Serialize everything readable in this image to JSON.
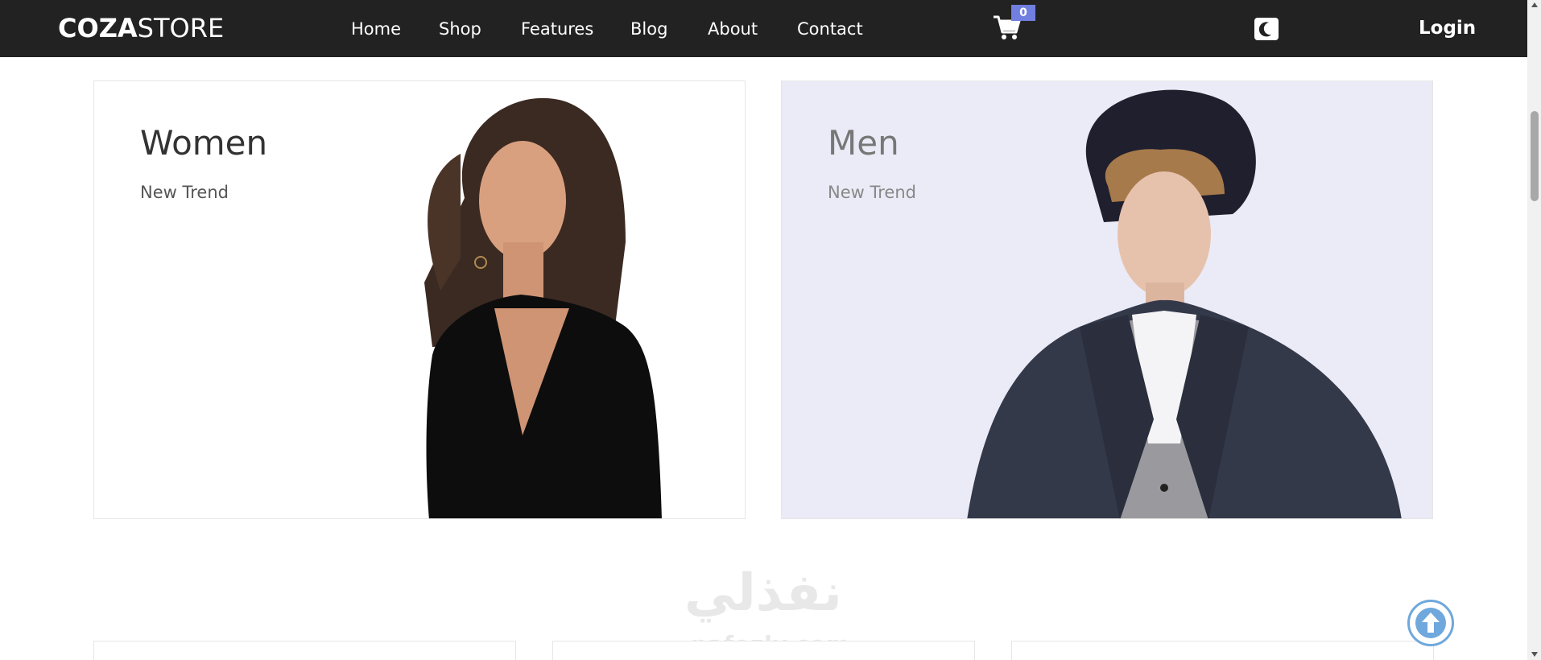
{
  "header": {
    "logo_bold": "COZA",
    "logo_light": "STORE",
    "nav": [
      "Home",
      "Shop",
      "Features",
      "Blog",
      "About",
      "Contact"
    ],
    "cart_count": "0",
    "login_label": "Login",
    "icons": {
      "cart": "cart-icon",
      "theme": "moon-icon"
    }
  },
  "banners": [
    {
      "title": "Women",
      "subtitle": "New Trend"
    },
    {
      "title": "Men",
      "subtitle": "New Trend"
    }
  ],
  "watermark": {
    "arabic": "نفذلي",
    "latin": "nafezly.com"
  },
  "colors": {
    "header_bg": "#222222",
    "accent": "#717fe0",
    "men_banner_bg": "#ebebf7",
    "back_to_top": "#6fa8dc"
  }
}
